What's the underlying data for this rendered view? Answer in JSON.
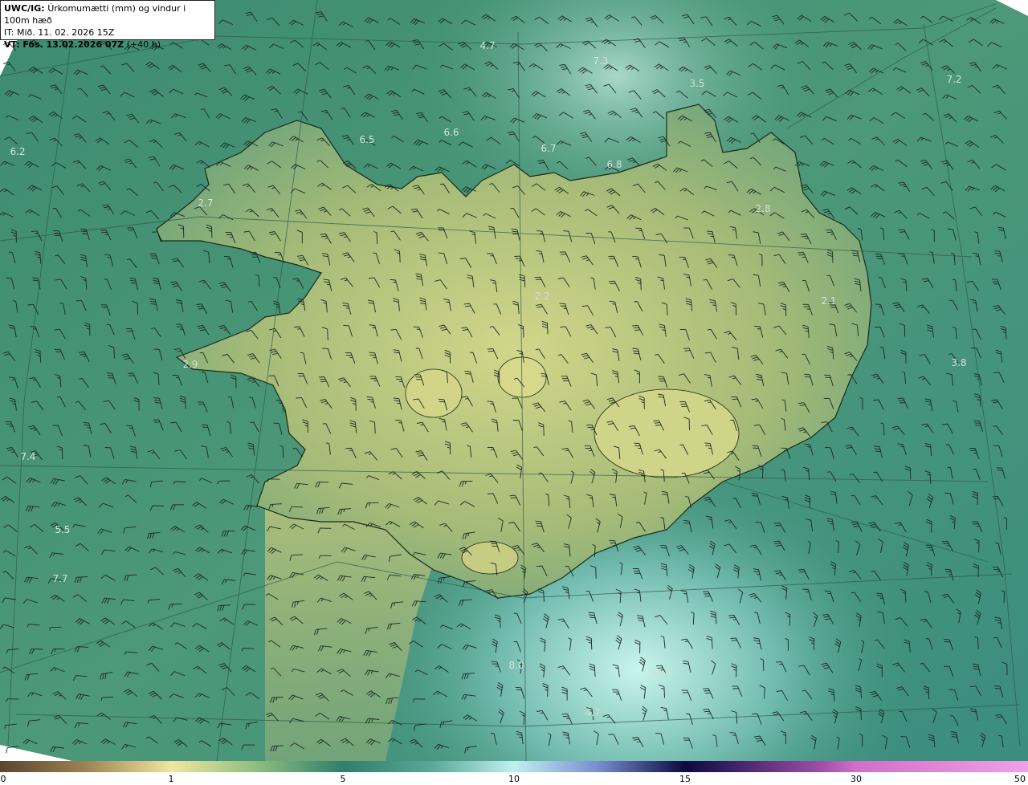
{
  "title": {
    "model": "UWC/IG:",
    "description": "Úrkomumætti (mm) og vindur i 100m hæð",
    "initial_time": "IT: Mið. 11. 02. 2026 15Z",
    "valid_prefix": "VT:",
    "valid_time": "Fös. 13.02.2026 07Z",
    "lead": "(+40 h)"
  },
  "map_labels": [
    {
      "text": "4.7"
    },
    {
      "text": "7.3"
    },
    {
      "text": "3.5"
    },
    {
      "text": "7.2"
    },
    {
      "text": "6.2"
    },
    {
      "text": "6.5"
    },
    {
      "text": "6.6"
    },
    {
      "text": "6.7"
    },
    {
      "text": "6.8"
    },
    {
      "text": "2.7"
    },
    {
      "text": "2.8"
    },
    {
      "text": "2.2"
    },
    {
      "text": "2.1"
    },
    {
      "text": "2.9"
    },
    {
      "text": "3.8"
    },
    {
      "text": "7.4"
    },
    {
      "text": "5.5"
    },
    {
      "text": "7.7"
    },
    {
      "text": "8.0"
    },
    {
      "text": "10.0"
    },
    {
      "text": "4.7"
    }
  ],
  "colorbar": {
    "ticks": [
      "0",
      "1",
      "5",
      "10",
      "15",
      "30",
      "50"
    ],
    "colors": [
      "#5a4630",
      "#b89a5a",
      "#f0e6a0",
      "#2f7f6a",
      "#4fa090",
      "#bff0f0",
      "#2a2a90",
      "#0a0a40",
      "#c060c0",
      "#f0a0e8"
    ]
  }
}
